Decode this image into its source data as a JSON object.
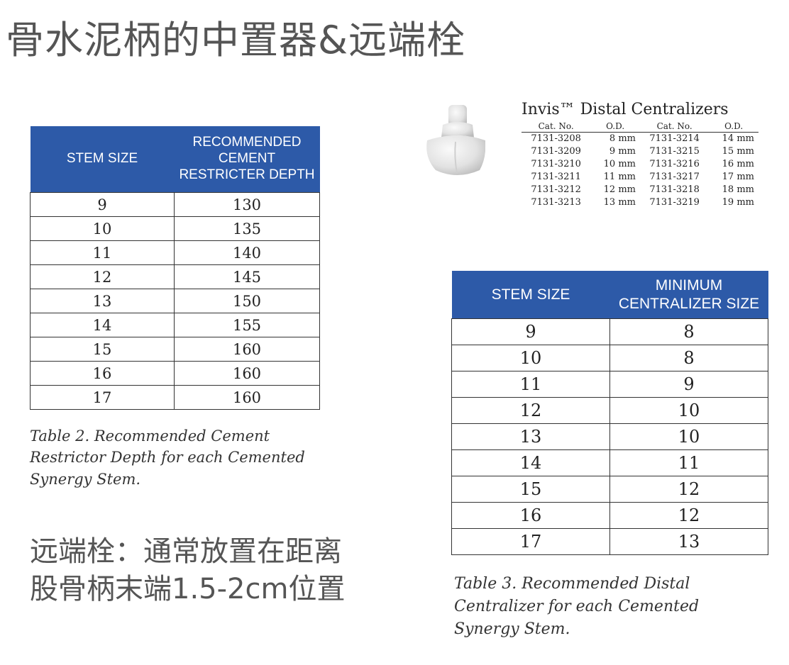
{
  "title": "骨水泥柄的中置器&远端栓",
  "table2": {
    "headers": [
      "STEM SIZE",
      "RECOMMENDED CEMENT RESTRICTER DEPTH"
    ],
    "rows": [
      [
        "9",
        "130"
      ],
      [
        "10",
        "135"
      ],
      [
        "11",
        "140"
      ],
      [
        "12",
        "145"
      ],
      [
        "13",
        "150"
      ],
      [
        "14",
        "155"
      ],
      [
        "15",
        "160"
      ],
      [
        "16",
        "160"
      ],
      [
        "17",
        "160"
      ]
    ],
    "caption": "Table 2. Recommended Cement Restrictor Depth for each Cemented Synergy Stem."
  },
  "note": [
    "远端栓：通常放置在距离",
    "股骨柄末端1.5-2cm位置"
  ],
  "invis": {
    "title": "Invis™ Distal Centralizers",
    "headers": [
      "Cat. No.",
      "O.D.",
      "Cat. No.",
      "O.D."
    ],
    "rows": [
      [
        "7131-3208",
        "8 mm",
        "7131-3214",
        "14 mm"
      ],
      [
        "7131-3209",
        "9 mm",
        "7131-3215",
        "15 mm"
      ],
      [
        "7131-3210",
        "10 mm",
        "7131-3216",
        "16 mm"
      ],
      [
        "7131-3211",
        "11 mm",
        "7131-3217",
        "17 mm"
      ],
      [
        "7131-3212",
        "12 mm",
        "7131-3218",
        "18 mm"
      ],
      [
        "7131-3213",
        "13 mm",
        "7131-3219",
        "19 mm"
      ]
    ]
  },
  "table3": {
    "headers": [
      "STEM SIZE",
      "MINIMUM CENTRALIZER SIZE"
    ],
    "rows": [
      [
        "9",
        "8"
      ],
      [
        "10",
        "8"
      ],
      [
        "11",
        "9"
      ],
      [
        "12",
        "10"
      ],
      [
        "13",
        "10"
      ],
      [
        "14",
        "11"
      ],
      [
        "15",
        "12"
      ],
      [
        "16",
        "12"
      ],
      [
        "17",
        "13"
      ]
    ],
    "caption": "Table 3. Recommended Distal Centralizer for each Cemented Synergy Stem."
  },
  "colors": {
    "header_blue": "#2d5aa8",
    "title_gray": "#555555"
  }
}
